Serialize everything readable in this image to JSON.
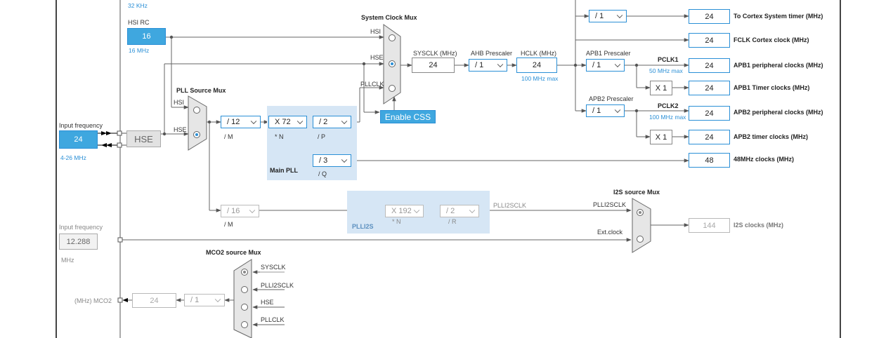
{
  "top_left_partial": "32 KHz",
  "hsi_rc": {
    "title": "HSI RC",
    "value": "16",
    "sublabel": "16 MHz"
  },
  "input_frequency": {
    "label": "Input frequency",
    "value": "24",
    "range": "4-26 MHz"
  },
  "hse_label": "HSE",
  "pll_source_mux": {
    "title": "PLL Source Mux",
    "in1": "HSI",
    "in2": "HSE"
  },
  "main_pll": {
    "title": "Main PLL",
    "m": "/ 12",
    "m_label": "/ M",
    "n": "X 72",
    "n_label": "* N",
    "p": "/ 2",
    "p_label": "/ P",
    "q": "/ 3",
    "q_label": "/ Q"
  },
  "system_clock_mux": {
    "title": "System Clock Mux",
    "in1": "HSI",
    "in2": "HSE",
    "in3": "PLLCLK"
  },
  "enable_css": "Enable CSS",
  "sysclk": {
    "label": "SYSCLK (MHz)",
    "value": "24"
  },
  "ahb_prescaler": {
    "label": "AHB Prescaler",
    "value": "/ 1"
  },
  "hclk": {
    "label": "HCLK (MHz)",
    "value": "24",
    "note": "100 MHz max"
  },
  "apb1_prescaler": {
    "label": "APB1 Prescaler",
    "value": "/ 1"
  },
  "apb2_prescaler": {
    "label": "APB2 Prescaler",
    "value": "/ 1"
  },
  "cortex_div": "/ 1",
  "pclk1": {
    "label": "PCLK1",
    "note": "50 MHz max"
  },
  "pclk2": {
    "label": "PCLK2",
    "note": "100 MHz max"
  },
  "apb1_timer_mult": "X 1",
  "apb2_timer_mult": "X 1",
  "outputs": [
    {
      "value": "24",
      "label": "To Cortex System timer (MHz)"
    },
    {
      "value": "24",
      "label": "FCLK Cortex clock (MHz)"
    },
    {
      "value": "24",
      "label": "APB1 peripheral clocks (MHz)"
    },
    {
      "value": "24",
      "label": "APB1 Timer clocks (MHz)"
    },
    {
      "value": "24",
      "label": "APB2 peripheral clocks (MHz)"
    },
    {
      "value": "24",
      "label": "APB2 timer clocks (MHz)"
    },
    {
      "value": "48",
      "label": "48MHz clocks (MHz)"
    }
  ],
  "plli2s": {
    "title": "PLLI2S",
    "m": "/ 16",
    "m_label": "/ M",
    "n": "X 192",
    "n_label": "* N",
    "r": "/ 2",
    "r_label": "/ R",
    "out_label": "PLLI2SCLK"
  },
  "i2s_mux": {
    "title": "I2S source Mux",
    "in1": "PLLI2SCLK",
    "in2": "Ext.clock"
  },
  "i2s_clocks": {
    "value": "144",
    "label": "I2S clocks (MHz)"
  },
  "ext_input": {
    "label": "Input frequency",
    "value": "12.288",
    "unit": "MHz"
  },
  "mco2_mux": {
    "title": "MCO2 source Mux",
    "in1": "SYSCLK",
    "in2": "PLLI2SCLK",
    "in3": "HSE",
    "in4": "PLLCLK"
  },
  "mco2": {
    "label": "(MHz) MCO2",
    "value": "24",
    "div": "/ 1"
  }
}
